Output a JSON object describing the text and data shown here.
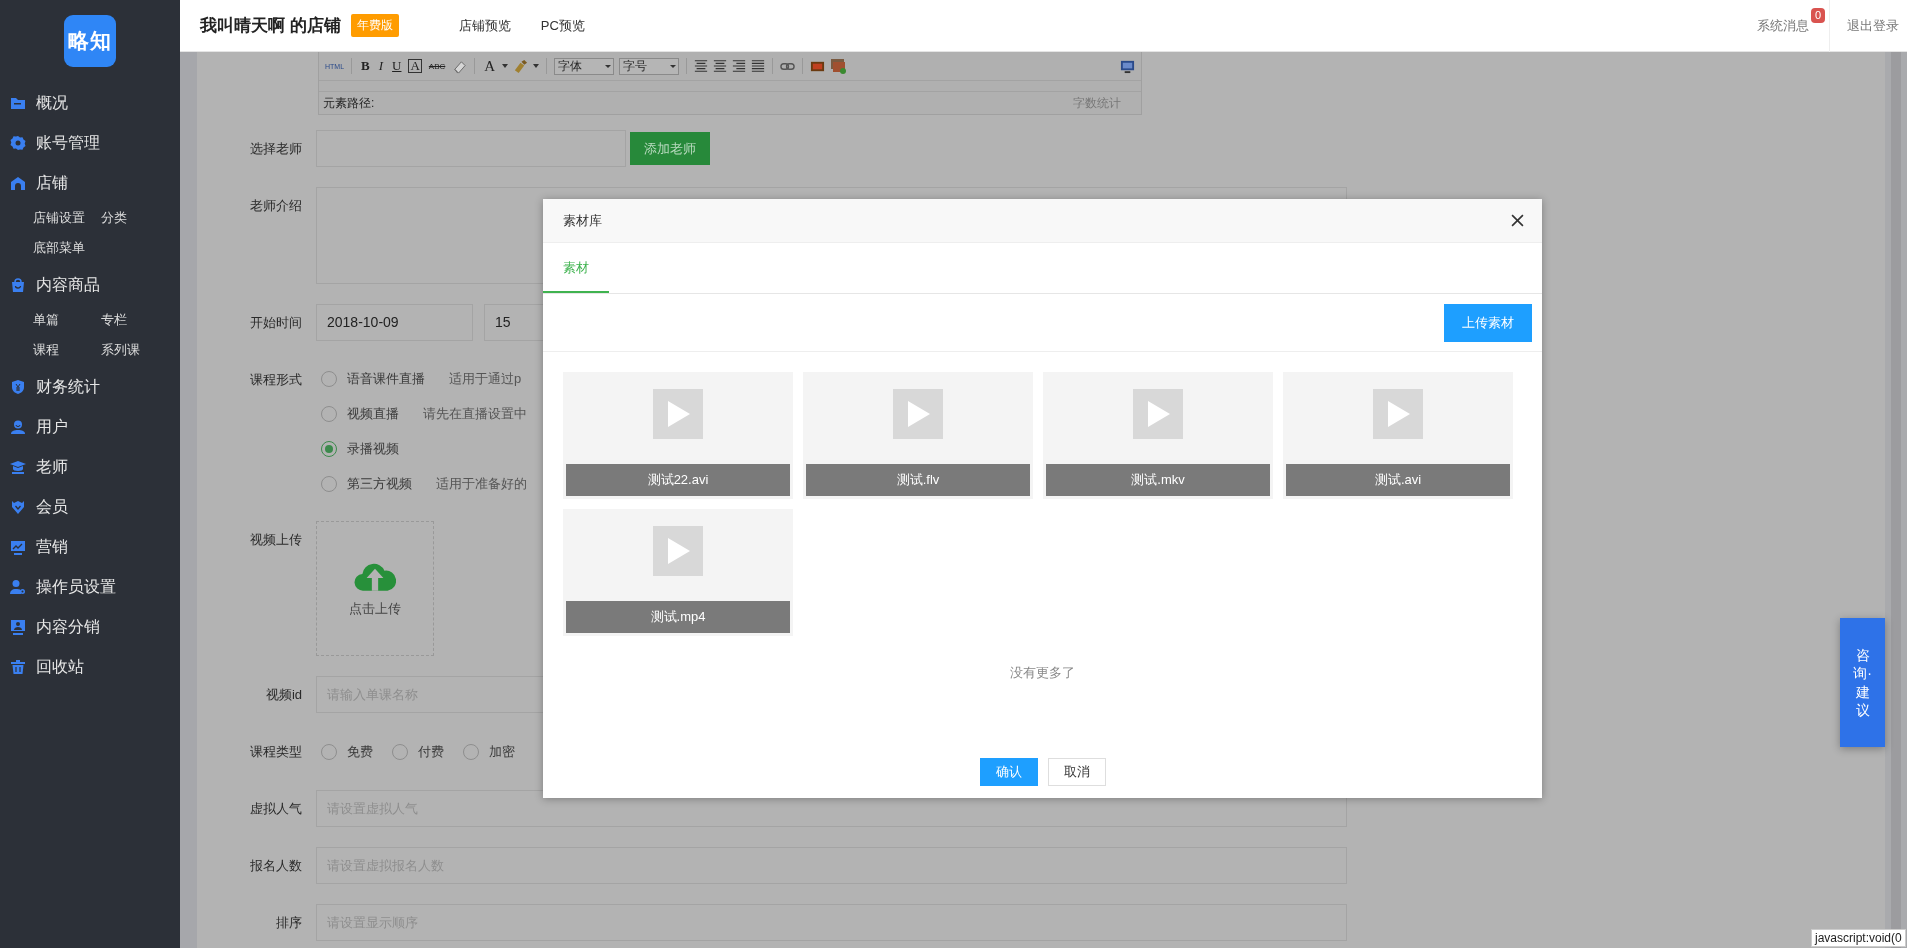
{
  "logo": {
    "text": "略知"
  },
  "header": {
    "shop_name": "我叫晴天啊 的店铺",
    "plan_badge": "年费版",
    "nav_links": [
      "店铺预览",
      "PC预览"
    ],
    "messages": {
      "label": "系统消息",
      "count": "0"
    },
    "logout": "退出登录"
  },
  "sidebar": {
    "items": [
      {
        "label": "概况"
      },
      {
        "label": "账号管理"
      },
      {
        "label": "店铺",
        "children": [
          {
            "label": "店铺设置"
          },
          {
            "label": "分类"
          },
          {
            "label": "底部菜单"
          }
        ]
      },
      {
        "label": "内容商品",
        "children": [
          {
            "label": "单篇"
          },
          {
            "label": "专栏"
          },
          {
            "label": "课程"
          },
          {
            "label": "系列课"
          }
        ]
      },
      {
        "label": "财务统计"
      },
      {
        "label": "用户"
      },
      {
        "label": "老师"
      },
      {
        "label": "会员"
      },
      {
        "label": "营销"
      },
      {
        "label": "操作员设置"
      },
      {
        "label": "内容分销"
      },
      {
        "label": "回收站"
      }
    ]
  },
  "editor": {
    "html_label": "HTML",
    "format_buttons": [
      {
        "text": "B",
        "kind": "bold"
      },
      {
        "text": "I",
        "kind": "italic"
      },
      {
        "text": "U",
        "kind": "underline"
      },
      {
        "text": "A",
        "kind": "boxed"
      },
      {
        "text": "ABC",
        "kind": "strike"
      }
    ],
    "font_color": "A",
    "selects": [
      "字体",
      "字号"
    ],
    "path_label": "元素路径:",
    "word_count": "字数统计"
  },
  "form": {
    "fields": [
      {
        "kind": "input",
        "label": "选择老师",
        "button": "添加老师"
      },
      {
        "kind": "textarea",
        "label": "老师介绍"
      },
      {
        "kind": "dates",
        "label": "开始时间",
        "values": [
          "2018-10-09",
          "15"
        ]
      },
      {
        "kind": "radio_list",
        "label": "课程形式",
        "options": [
          {
            "label": "语音课件直播",
            "hint": "适用于通过p",
            "selected": false
          },
          {
            "label": "视频直播",
            "hint": "请先在直播设置中",
            "selected": false
          },
          {
            "label": "录播视频",
            "selected": true
          },
          {
            "label": "第三方视频",
            "hint": "适用于准备好的",
            "selected": false
          }
        ]
      },
      {
        "kind": "upload",
        "label": "视频上传",
        "text": "点击上传"
      },
      {
        "kind": "input",
        "label": "视频id",
        "placeholder": "请输入单课名称"
      },
      {
        "kind": "radio_row",
        "label": "课程类型",
        "options": [
          {
            "label": "免费",
            "selected": false
          },
          {
            "label": "付费",
            "selected": false
          },
          {
            "label": "加密",
            "selected": false
          }
        ]
      },
      {
        "kind": "input",
        "label": "虚拟人气",
        "placeholder": "请设置虚拟人气"
      },
      {
        "kind": "input",
        "label": "报名人数",
        "placeholder": "请设置虚拟报名人数"
      },
      {
        "kind": "input",
        "label": "排序",
        "placeholder": "请设置显示顺序"
      }
    ]
  },
  "modal": {
    "title": "素材库",
    "tabs": [
      {
        "label": "素材",
        "selected": true
      }
    ],
    "upload_button": "上传素材",
    "items": [
      "测试22.avi",
      "测试.flv",
      "测试.mkv",
      "测试.avi",
      "测试.mp4"
    ],
    "end_text": "没有更多了",
    "buttons": [
      {
        "label": "确认",
        "kind": "primary"
      },
      {
        "label": "取消",
        "kind": "default"
      }
    ]
  },
  "consult_button": "咨询·建议",
  "status_url": "javascript:void(0"
}
